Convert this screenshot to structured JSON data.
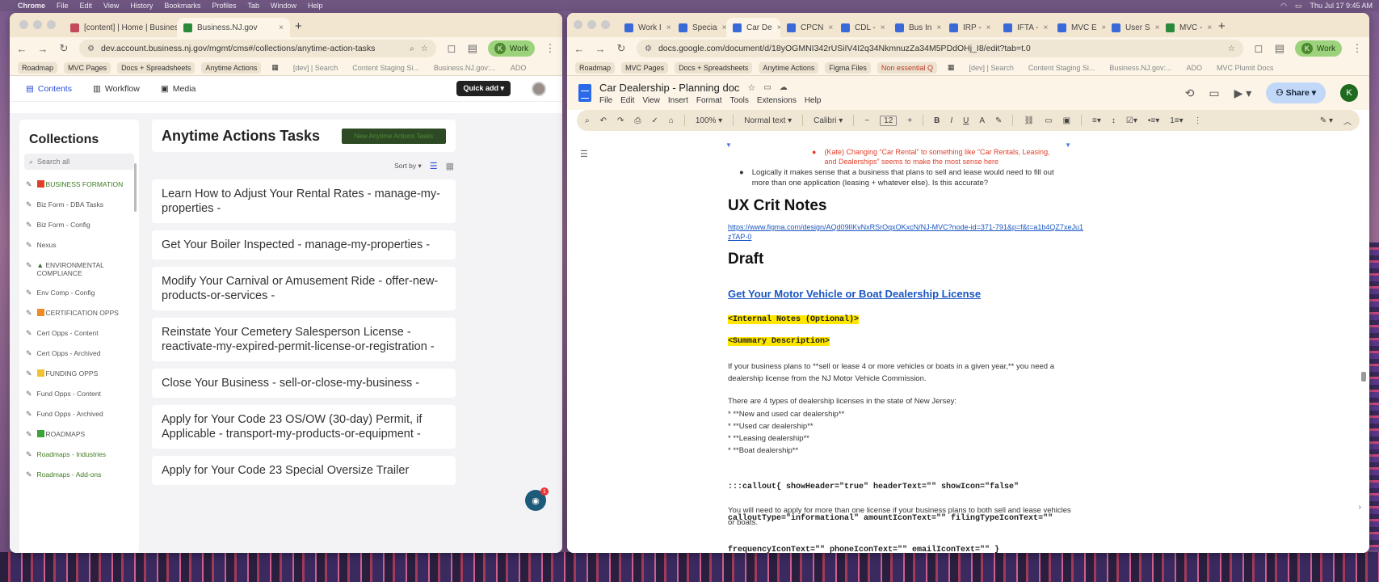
{
  "menubar": {
    "app": "Chrome",
    "items": [
      "File",
      "Edit",
      "View",
      "History",
      "Bookmarks",
      "Profiles",
      "Tab",
      "Window",
      "Help"
    ],
    "datetime": "Thu Jul 17  9:45 AM"
  },
  "left": {
    "tabs": [
      {
        "label": "[content] | Home | Business I",
        "color": "#c24a5a"
      },
      {
        "label": "Business.NJ.gov",
        "color": "#2a8a3a"
      }
    ],
    "url": "dev.account.business.nj.gov/mgmt/cms#/collections/anytime-action-tasks",
    "profile": "Work",
    "bookmarks": [
      "Roadmap",
      "MVC Pages",
      "Docs + Spreadsheets",
      "Anytime Actions",
      "[dev] | Search",
      "Content Staging Si...",
      "Business.NJ.gov:...",
      "ADO"
    ],
    "cms": {
      "tabs": [
        "Contents",
        "Workflow",
        "Media"
      ],
      "quick_add": "Quick add",
      "collections_title": "Collections",
      "search_placeholder": "Search all",
      "collections": [
        {
          "label": "BUSINESS FORMATION",
          "prefix": "red-square",
          "green": true
        },
        {
          "label": "Biz Form - DBA Tasks",
          "green": false
        },
        {
          "label": "Biz Form - Config",
          "green": false
        },
        {
          "label": "Nexus",
          "green": false
        },
        {
          "label": "ENVIRONMENTAL COMPLIANCE",
          "prefix": "tree",
          "green": false
        },
        {
          "label": "Env Comp - Config",
          "green": false
        },
        {
          "label": "CERTIFICATION OPPS",
          "prefix": "orange-square",
          "green": false
        },
        {
          "label": "Cert Opps - Content",
          "green": false
        },
        {
          "label": "Cert Opps - Archived",
          "green": false
        },
        {
          "label": "FUNDING OPPS",
          "prefix": "yellow-square",
          "green": false
        },
        {
          "label": "Fund Opps - Content",
          "green": false
        },
        {
          "label": "Fund Opps - Archived",
          "green": false
        },
        {
          "label": "ROADMAPS",
          "prefix": "green-square",
          "green": false
        },
        {
          "label": "Roadmaps - Industries",
          "green": true
        },
        {
          "label": "Roadmaps - Add-ons",
          "green": true
        }
      ],
      "heading": "Anytime Actions Tasks",
      "new_button": "New Anytime Actions Tasks",
      "sort_by": "Sort by",
      "entries": [
        "Learn How to Adjust Your Rental Rates - manage-my-properties -",
        "Get Your Boiler Inspected - manage-my-properties -",
        "Modify Your Carnival or Amusement Ride - offer-new-products-or-services -",
        "Reinstate Your Cemetery Salesperson License - reactivate-my-expired-permit-license-or-registration -",
        "Close Your Business - sell-or-close-my-business -",
        "Apply for Your Code 23 OS/OW (30-day) Permit, if Applicable - transport-my-products-or-equipment -",
        "Apply for Your Code 23 Special Oversize Trailer"
      ],
      "chat_badge": "1"
    }
  },
  "right": {
    "tabs": [
      "Work I",
      "Specia",
      "Car De",
      "CPCN",
      "CDL -",
      "Bus In",
      "IRP -",
      "IFTA -",
      "MVC E",
      "User S",
      "MVC -"
    ],
    "active_tab": 2,
    "url": "docs.google.com/document/d/18yOGMNI342rUSiIV4I2q34NkmnuzZa34M5PDdOHj_I8/edit?tab=t.0",
    "profile": "Work",
    "bookmarks": [
      "Roadmap",
      "MVC Pages",
      "Docs + Spreadsheets",
      "Anytime Actions",
      "Figma Files",
      "Non essential Q",
      "[dev] | Search",
      "Content Staging Si...",
      "Business.NJ.gov:...",
      "ADO",
      "MVC Plumit Docs"
    ],
    "doc": {
      "title": "Car Dealership - Planning doc",
      "menus": [
        "File",
        "Edit",
        "View",
        "Insert",
        "Format",
        "Tools",
        "Extensions",
        "Help"
      ],
      "share": "Share",
      "avatar": "K",
      "toolbar": {
        "zoom": "100%",
        "style": "Normal text",
        "font": "Calibri",
        "size": "12"
      },
      "content": {
        "red_note": "(Kate) Changing “Car Rental” to something like “Car Rentals, Leasing, and Dealerships” seems to make the most sense here",
        "bullet": "Logically it makes sense that a business that plans to sell and lease would need to fill out more than one application (leasing + whatever else). Is this accurate?",
        "h_ux": "UX Crit Notes",
        "figma_link": "https://www.figma.com/design/AQd09lIKvNxRSrOqxOKxcN/NJ-MVC?node-id=371-791&p=f&t=a1b4QZ7xeJu1zTAP-0",
        "h_draft": "Draft",
        "doc_link": "Get Your Motor Vehicle or Boat Dealership License",
        "internal": "<Internal Notes (Optional)>",
        "summary": "<Summary Description>",
        "p1": "If your business plans to **sell or lease 4 or more vehicles or boats in a given year,** you need a dealership license from the NJ Motor Vehicle Commission.",
        "p2": "There are 4 types of dealership licenses in the state of New Jersey:",
        "list": [
          "*  **New and used car dealership**",
          "*  **Used car dealership**",
          "*  **Leasing dealership**",
          "*  **Boat dealership**"
        ],
        "code1": ":::callout{ showHeader=\"true\" headerText=\"\" showIcon=\"false\"",
        "code2": "calloutType=\"informational\" amountIconText=\"\" filingTypeIconText=\"\"",
        "code3": "frequencyIconText=\"\" phoneIconText=\"\" emailIconText=\"\" }",
        "p3": "You will need to apply for more than one license if your business plans to both sell and lease vehicles or boats."
      }
    }
  }
}
